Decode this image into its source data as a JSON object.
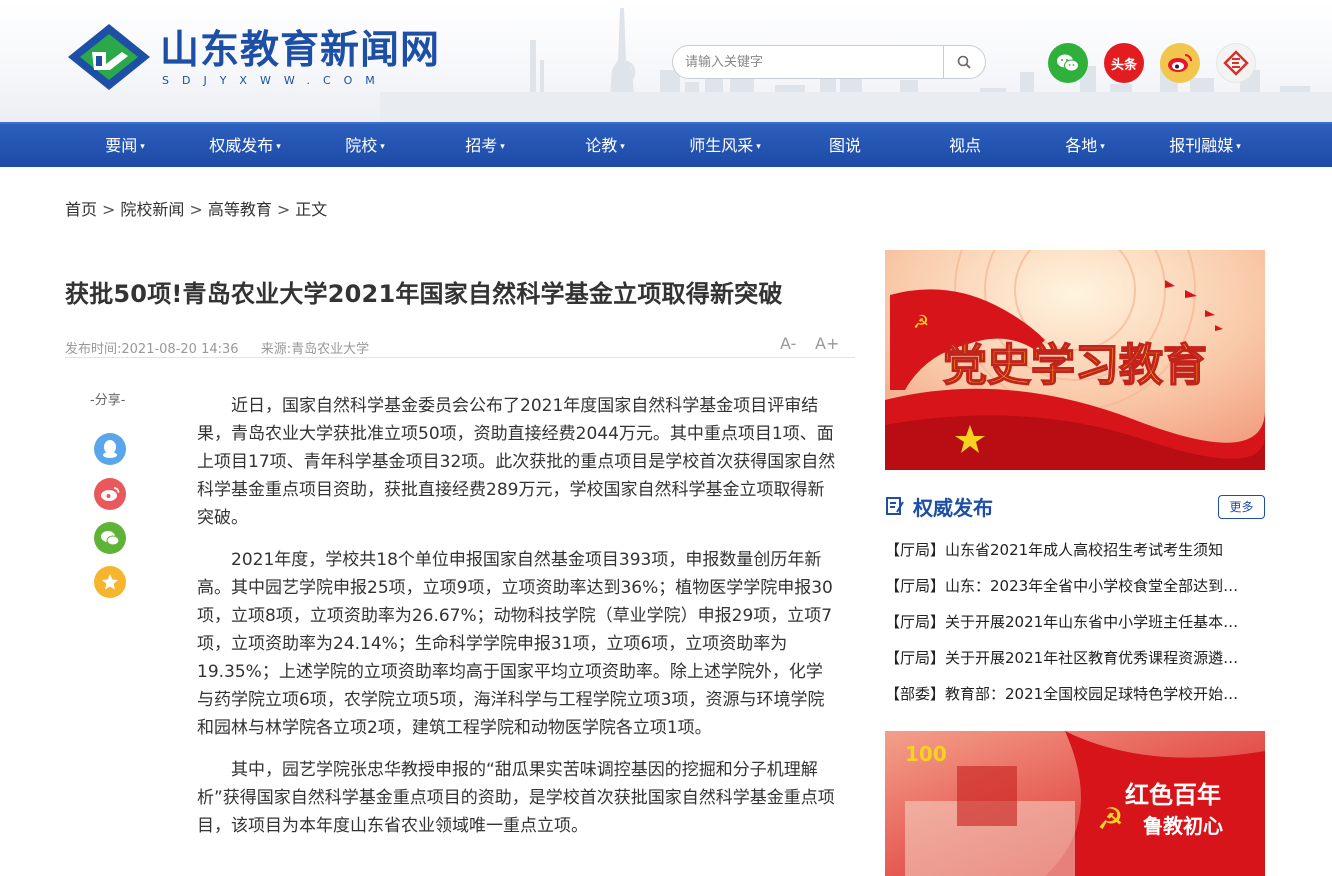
{
  "site": {
    "name": "山东教育新闻网",
    "domain_text": "SDJYXWW.COM"
  },
  "search": {
    "placeholder": "请输入关键字"
  },
  "social": {
    "toutiao_label": "头条"
  },
  "nav": [
    {
      "label": "要闻",
      "dropdown": true
    },
    {
      "label": "权威发布",
      "dropdown": true
    },
    {
      "label": "院校",
      "dropdown": true
    },
    {
      "label": "招考",
      "dropdown": true
    },
    {
      "label": "论教",
      "dropdown": true
    },
    {
      "label": "师生风采",
      "dropdown": true
    },
    {
      "label": "图说",
      "dropdown": false
    },
    {
      "label": "视点",
      "dropdown": false
    },
    {
      "label": "各地",
      "dropdown": true
    },
    {
      "label": "报刊融媒",
      "dropdown": true
    }
  ],
  "nav_caret": "▾",
  "breadcrumb": {
    "items": [
      "首页",
      "院校新闻",
      "高等教育",
      "正文"
    ],
    "separator": ">"
  },
  "article": {
    "title": "获批50项!青岛农业大学2021年国家自然科学基金立项取得新突破",
    "publish_label": "发布时间:",
    "publish_time": "2021-08-20 14:36",
    "source_label": "来源:",
    "source": "青岛农业大学",
    "font_minus": "A-",
    "font_plus": "A+",
    "share_label": "-分享-",
    "paragraphs": [
      "近日，国家自然科学基金委员会公布了2021年度国家自然科学基金项目评审结果，青岛农业大学获批准立项50项，资助直接经费2044万元。其中重点项目1项、面上项目17项、青年科学基金项目32项。此次获批的重点项目是学校首次获得国家自然科学基金重点项目资助，获批直接经费289万元，学校国家自然科学基金立项取得新突破。",
      "2021年度，学校共18个单位申报国家自然基金项目393项，申报数量创历年新高。其中园艺学院申报25项，立项9项，立项资助率达到36%；植物医学学院申报30项，立项8项，立项资助率为26.67%；动物科技学院（草业学院）申报29项，立项7项，立项资助率为24.14%；生命科学学院申报31项，立项6项，立项资助率为19.35%；上述学院的立项资助率均高于国家平均立项资助率。除上述学院外，化学与药学院立项6项，农学院立项5项，海洋科学与工程学院立项3项，资源与环境学院和园林与林学院各立项2项，建筑工程学院和动物医学院各立项1项。",
      "其中，园艺学院张忠华教授申报的“甜瓜果实苦味调控基因的挖掘和分子机理解析”获得国家自然科学基金重点项目的资助，是学校首次获批国家自然科学基金重点项目，该项目为本年度山东省农业领域唯一重点立项。"
    ]
  },
  "sidebar": {
    "banner1_text": "党史学习教育",
    "section_title": "权威发布",
    "more_label": "更多",
    "news": [
      "【厅局】山东省2021年成人高校招生考试考生须知",
      "【厅局】山东：2023年全省中小学校食堂全部达到…",
      "【厅局】关于开展2021年山东省中小学班主任基本…",
      "【厅局】关于开展2021年社区教育优秀课程资源遴…",
      "【部委】教育部：2021全国校园足球特色学校开始…"
    ],
    "banner2_number": "100",
    "banner2_line1": "红色百年",
    "banner2_line2": "鲁教初心"
  },
  "colors": {
    "brand_blue": "#1c4fa5",
    "nav_blue": "#2556b4",
    "banner_red": "#d8141b"
  }
}
